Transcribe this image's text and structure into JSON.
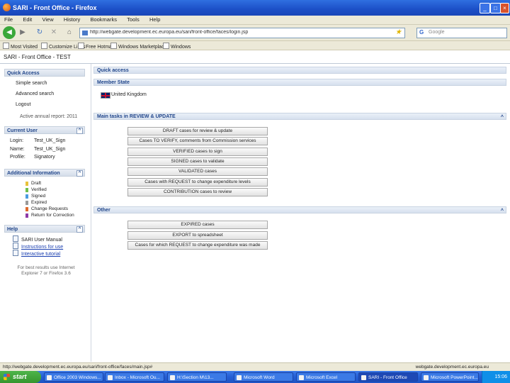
{
  "window": {
    "title": "SARI - Front Office - Firefox"
  },
  "menu": [
    "File",
    "Edit",
    "View",
    "History",
    "Bookmarks",
    "Tools",
    "Help"
  ],
  "nav": {
    "url": "http://webgate.development.ec.europa.eu/sari/front-office/faces/login.jsp",
    "search_placeholder": "Google",
    "search_badge": "G"
  },
  "bookmarks": [
    "Most Visited",
    "Customize Links",
    "Free Hotmail",
    "Windows Marketplace",
    "Windows"
  ],
  "app": {
    "header": "SARI - Front Office - TEST"
  },
  "left": {
    "menu_title": "Quick Access",
    "menu_items": [
      "Simple search",
      "Advanced search",
      "Logout"
    ],
    "report": "Active annual report: 2011",
    "current_user": {
      "title": "Current User",
      "rows": [
        {
          "label": "Login:",
          "value": "Test_UK_Sign"
        },
        {
          "label": "Name:",
          "value": "Test_UK_Sign"
        },
        {
          "label": "Profile:",
          "value": "Signatory"
        }
      ]
    },
    "additional": {
      "title": "Additional Information",
      "legend": [
        {
          "label": "Draft",
          "color": "#e8c23a"
        },
        {
          "label": "Verified",
          "color": "#6fbf4b"
        },
        {
          "label": "Signed",
          "color": "#4a9be0"
        },
        {
          "label": "Expired",
          "color": "#9a9a9a"
        },
        {
          "label": "Change Requests",
          "color": "#e06a2c"
        },
        {
          "label": "Return for Correction",
          "color": "#8d3aa8"
        }
      ]
    },
    "help": {
      "title": "Help",
      "items": [
        "SARI User Manual",
        "Instructions for use",
        "Interactive tutorial"
      ]
    },
    "footer": "For best results use Internet Explorer 7 or Firefox 3.6"
  },
  "main": {
    "quick_access_title": "Quick access",
    "member_state_title": "Member State",
    "member_state_value": "United Kingdom",
    "tasks_title": "Main tasks in REVIEW & UPDATE",
    "tasks": [
      "DRAFT cases for review & update",
      "Cases TO VERIFY, comments from Commission services",
      "VERIFIED cases to sign",
      "SIGNED cases to validate",
      "VALIDATED cases",
      "Cases with REQUEST to change expenditure levels",
      "CONTRIBUTION cases to review"
    ],
    "other_title": "Other",
    "other": [
      "EXPIRED cases",
      "EXPORT to spreadsheet",
      "Cases for which REQUEST to change expenditure was made"
    ]
  },
  "status": {
    "left": "http://webgate.development.ec.europa.eu/sari/front-office/faces/main.jsp#",
    "right": "webgate.development.ec.europa.eu"
  },
  "taskbar": {
    "start": "start",
    "tasks": [
      "Office 2003 Windows...",
      "Inbox - Microsoft Ou...",
      "H:\\Section M\\13...",
      "Microsoft Word",
      "Microsoft Excel",
      "SARI - Front Office",
      "Microsoft PowerPoint..."
    ],
    "clock": "15:06"
  }
}
